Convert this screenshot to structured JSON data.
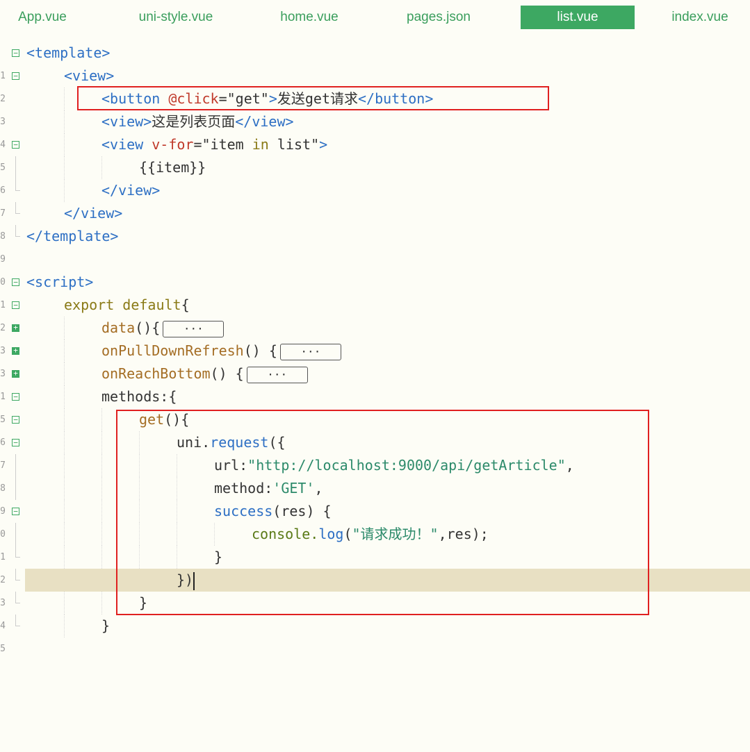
{
  "tabs": [
    {
      "label": "App.vue",
      "active": false
    },
    {
      "label": "uni-style.vue",
      "active": false
    },
    {
      "label": "home.vue",
      "active": false
    },
    {
      "label": "pages.json",
      "active": false
    },
    {
      "label": "list.vue",
      "active": true
    },
    {
      "label": "index.vue",
      "active": false
    }
  ],
  "line_numbers": [
    "1",
    "2",
    "3",
    "4",
    "5",
    "6",
    "7",
    "8",
    "9",
    "0",
    "1",
    "2",
    "3",
    "3",
    "1",
    "5",
    "6",
    "7",
    "8",
    "9",
    "0",
    "1",
    "2",
    "3",
    "4",
    "5"
  ],
  "code": {
    "l1": {
      "a": "<template>"
    },
    "l2": {
      "a": "<view>"
    },
    "l3": {
      "a": "<button ",
      "b": "@click",
      "c": "=",
      "d": "\"get\"",
      "e": ">",
      "f": "发送get请求",
      "g": "</button>"
    },
    "l4": {
      "a": "<view>",
      "b": "这是列表页面",
      "c": "</view>"
    },
    "l5": {
      "a": "<view ",
      "b": "v-for",
      "c": "=",
      "d": "\"item ",
      "e": "in",
      "f": " list\"",
      "g": ">"
    },
    "l6": {
      "a": "{{item}}"
    },
    "l7": {
      "a": "</view>"
    },
    "l8": {
      "a": "</view>"
    },
    "l9": {
      "a": "</template>"
    },
    "l11": {
      "a": "<script>"
    },
    "l12": {
      "a": "export ",
      "b": "default",
      "c": "{"
    },
    "l13": {
      "a": "data",
      "b": "(){",
      "c": "···"
    },
    "l14": {
      "a": "onPullDownRefresh",
      "b": "() {",
      "c": "···"
    },
    "l15": {
      "a": "onReachBottom",
      "b": "() {",
      "c": "···"
    },
    "l16": {
      "a": "methods:{"
    },
    "l17": {
      "a": "get",
      "b": "(){"
    },
    "l18": {
      "a": "uni.",
      "b": "request",
      "c": "({"
    },
    "l19": {
      "a": "url:",
      "b": "\"http://localhost:9000/api/getArticle\"",
      "c": ","
    },
    "l20": {
      "a": "method:",
      "b": "'GET'",
      "c": ","
    },
    "l21": {
      "a": "success",
      "b": "(res) {"
    },
    "l22": {
      "a": "console.",
      "b": "log",
      "c": "(",
      "d": "\"请求成功！\"",
      "e": ",res);"
    },
    "l23": {
      "a": "}"
    },
    "l24": {
      "a": "})"
    },
    "l25": {
      "a": "}"
    },
    "l26": {
      "a": "}"
    }
  },
  "colors": {
    "tab_text": "#3a9e5c",
    "tab_active_bg": "#3da862",
    "highlight_box": "#e02020",
    "current_line": "#e8e0c3"
  }
}
